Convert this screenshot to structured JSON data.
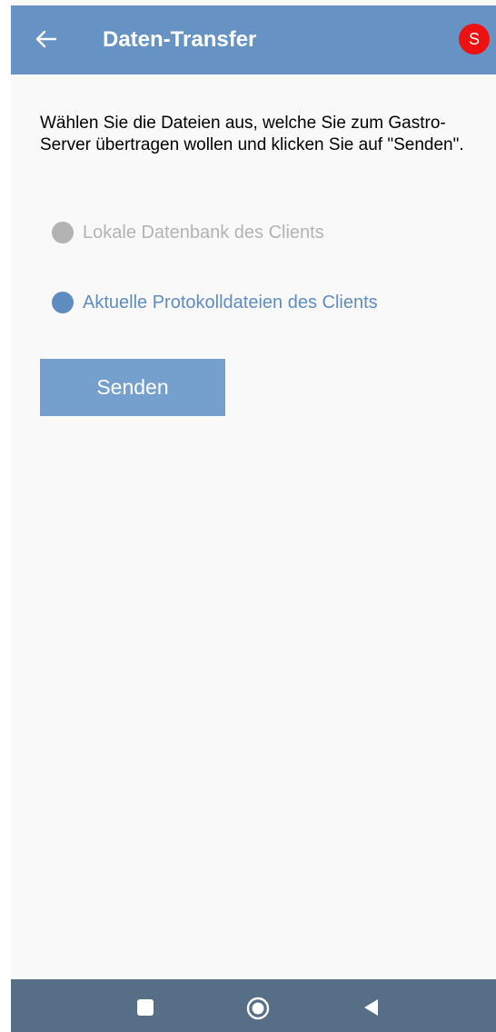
{
  "app_bar": {
    "title": "Daten-Transfer",
    "back_icon": "arrow-left-icon",
    "avatar_letter": "S",
    "bar_color": "#6693c3",
    "avatar_color": "#ee1111"
  },
  "main": {
    "instructions": "Wählen Sie die Dateien aus, welche Sie zum Gastro-Server übertragen wollen und klicken Sie auf \"Senden\".",
    "options": [
      {
        "label": "Lokale Datenbank des Clients",
        "state": "disabled",
        "color": "#b3b3b3"
      },
      {
        "label": "Aktuelle Protokolldateien des Clients",
        "state": "selected",
        "color": "#5f8dc0"
      }
    ],
    "send_label": "Senden",
    "send_color": "#759fcc"
  },
  "system_nav": {
    "recents_icon": "square-icon",
    "home_icon": "circle-home-icon",
    "back_icon": "triangle-back-icon",
    "bar_color": "#566e86"
  }
}
